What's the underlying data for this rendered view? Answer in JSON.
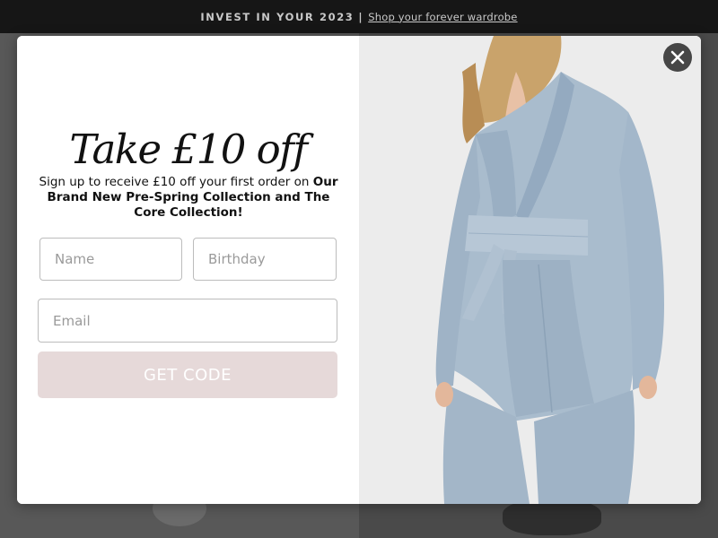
{
  "announcement": {
    "lead": "INVEST IN YOUR 2023",
    "separator": "|",
    "link": "Shop your forever wardrobe"
  },
  "popup": {
    "headline": "Take £10 off",
    "subtext_plain": "Sign up to receive £10 off your first order on ",
    "subtext_bold": "Our Brand New Pre-Spring Collection and The Core Collection!",
    "fields": {
      "name_placeholder": "Name",
      "birthday_placeholder": "Birthday",
      "email_placeholder": "Email"
    },
    "cta_label": "GET CODE",
    "close_icon": "close-icon"
  },
  "colors": {
    "cta_background": "#e6d9d9",
    "announcement_background": "#161616",
    "close_button": "#464646"
  }
}
